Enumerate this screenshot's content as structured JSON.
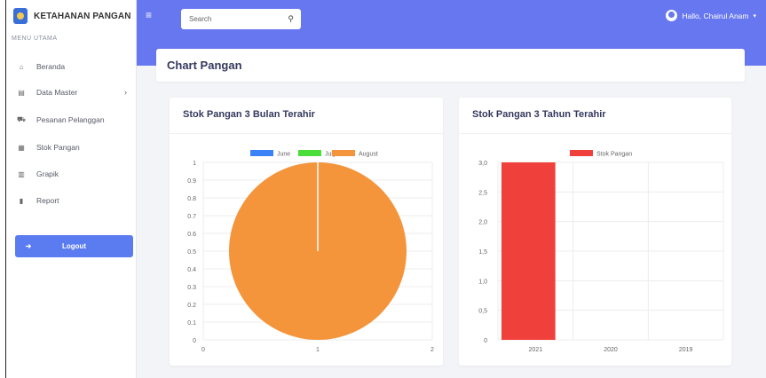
{
  "brand": {
    "name": "KETAHANAN PANGAN"
  },
  "sidebar": {
    "menu_label": "MENU UTAMA",
    "items": [
      {
        "label": "Beranda",
        "icon": "home-icon"
      },
      {
        "label": "Data Master",
        "icon": "database-icon"
      },
      {
        "label": "Pesanan Pelanggan",
        "icon": "truck-icon"
      },
      {
        "label": "Stok Pangan",
        "icon": "boxes-icon"
      },
      {
        "label": "Grapik",
        "icon": "chart-icon"
      },
      {
        "label": "Report",
        "icon": "file-icon"
      }
    ],
    "logout": "Logout"
  },
  "topbar": {
    "search_placeholder": "Search",
    "user": "Hallo, Chairul Anam"
  },
  "page": {
    "title": "Chart Pangan"
  },
  "colors": {
    "primary": "#6777ef",
    "june": "#3b82f6",
    "july": "#4ade3a",
    "august": "#f4943b",
    "stok": "#f0403c"
  },
  "charts": [
    {
      "title": "Stok Pangan 3 Bulan Terahir"
    },
    {
      "title": "Stok Pangan 3 Tahun Terahir"
    }
  ],
  "chart_data": [
    {
      "type": "pie",
      "legend": [
        "June",
        "July",
        "August"
      ],
      "values": [
        0,
        0,
        1
      ],
      "y_ticks": [
        "1",
        "0.9",
        "0.8",
        "0.7",
        "0.6",
        "0.5",
        "0.4",
        "0.3",
        "0.2",
        "0.1",
        "0"
      ],
      "x_ticks": [
        "0",
        "1",
        "2"
      ],
      "ylim": [
        0,
        1
      ],
      "xlim": [
        0,
        2
      ],
      "legend_position": "top"
    },
    {
      "type": "bar",
      "series": [
        {
          "name": "Stok Pangan",
          "values": [
            3,
            0,
            0
          ]
        }
      ],
      "categories": [
        "2021",
        "2020",
        "2019"
      ],
      "y_ticks": [
        "3,0",
        "2,5",
        "2,0",
        "1,5",
        "1,0",
        "0,5",
        "0"
      ],
      "ylim": [
        0,
        3
      ],
      "legend_position": "top"
    }
  ]
}
